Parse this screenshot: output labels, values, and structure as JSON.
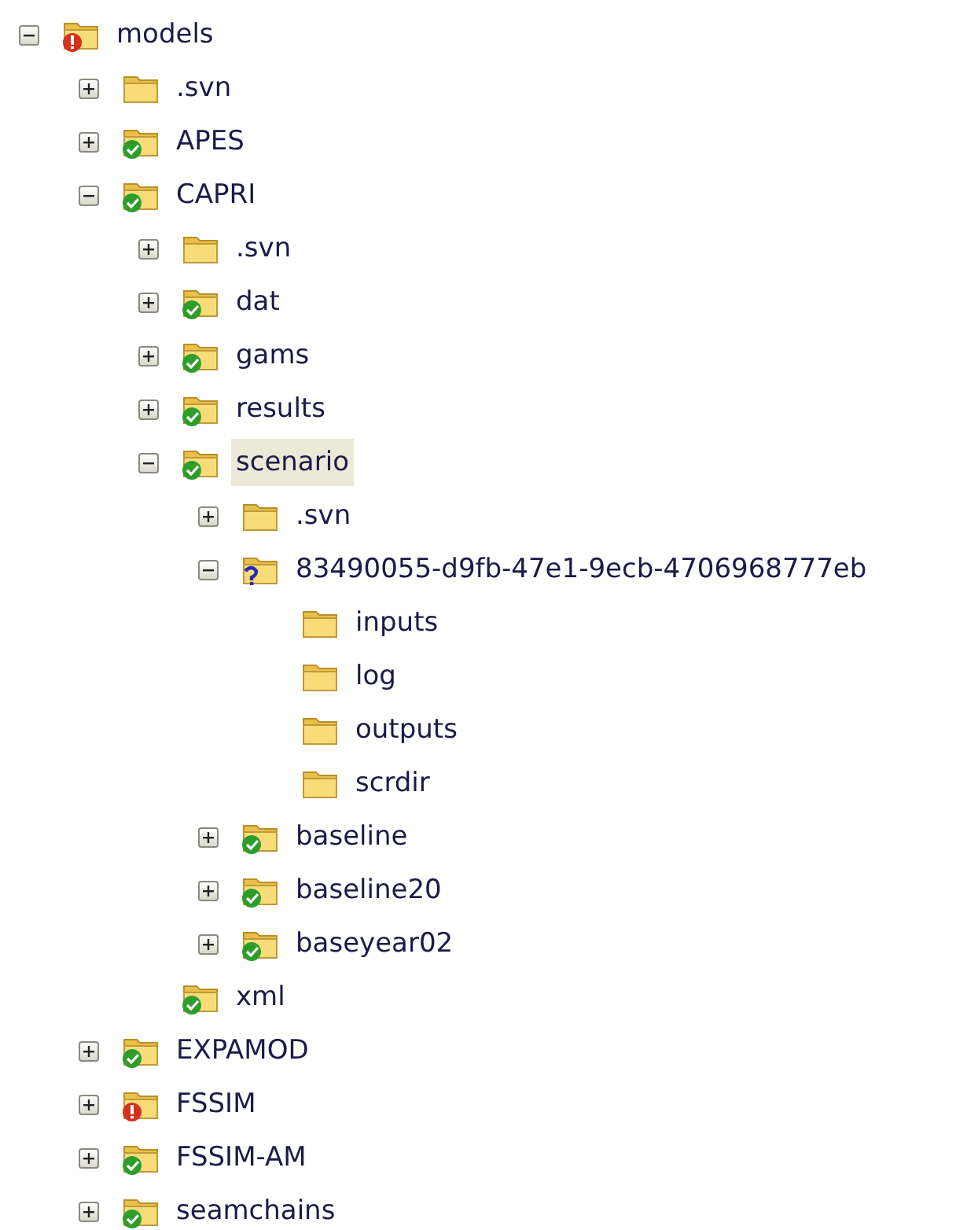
{
  "tree": [
    {
      "label": "models",
      "kind": "conflict",
      "expanded": true,
      "selected": false,
      "children": [
        {
          "label": ".svn",
          "kind": "plain",
          "expanded": false,
          "selected": false
        },
        {
          "label": "APES",
          "kind": "normal",
          "expanded": false,
          "selected": false
        },
        {
          "label": "CAPRI",
          "kind": "normal",
          "expanded": true,
          "selected": false,
          "children": [
            {
              "label": ".svn",
              "kind": "plain",
              "expanded": false,
              "selected": false
            },
            {
              "label": "dat",
              "kind": "normal",
              "expanded": false,
              "selected": false
            },
            {
              "label": "gams",
              "kind": "normal",
              "expanded": false,
              "selected": false
            },
            {
              "label": "results",
              "kind": "normal",
              "expanded": false,
              "selected": false
            },
            {
              "label": "scenario",
              "kind": "normal",
              "expanded": true,
              "selected": true,
              "children": [
                {
                  "label": ".svn",
                  "kind": "plain",
                  "expanded": false,
                  "selected": false
                },
                {
                  "label": "83490055-d9fb-47e1-9ecb-4706968777eb",
                  "kind": "unversioned",
                  "expanded": true,
                  "selected": false,
                  "children": [
                    {
                      "label": "inputs",
                      "kind": "plain",
                      "selected": false
                    },
                    {
                      "label": "log",
                      "kind": "plain",
                      "selected": false
                    },
                    {
                      "label": "outputs",
                      "kind": "plain",
                      "selected": false
                    },
                    {
                      "label": "scrdir",
                      "kind": "plain",
                      "selected": false
                    }
                  ]
                },
                {
                  "label": "baseline",
                  "kind": "normal",
                  "expanded": false,
                  "selected": false
                },
                {
                  "label": "baseline20",
                  "kind": "normal",
                  "expanded": false,
                  "selected": false
                },
                {
                  "label": "baseyear02",
                  "kind": "normal",
                  "expanded": false,
                  "selected": false
                }
              ]
            },
            {
              "label": "xml",
              "kind": "normal",
              "selected": false
            }
          ]
        },
        {
          "label": "EXPAMOD",
          "kind": "normal",
          "expanded": false,
          "selected": false
        },
        {
          "label": "FSSIM",
          "kind": "conflict",
          "expanded": false,
          "selected": false
        },
        {
          "label": "FSSIM-AM",
          "kind": "normal",
          "expanded": false,
          "selected": false
        },
        {
          "label": "seamchains",
          "kind": "normal",
          "expanded": false,
          "selected": false
        }
      ]
    }
  ]
}
